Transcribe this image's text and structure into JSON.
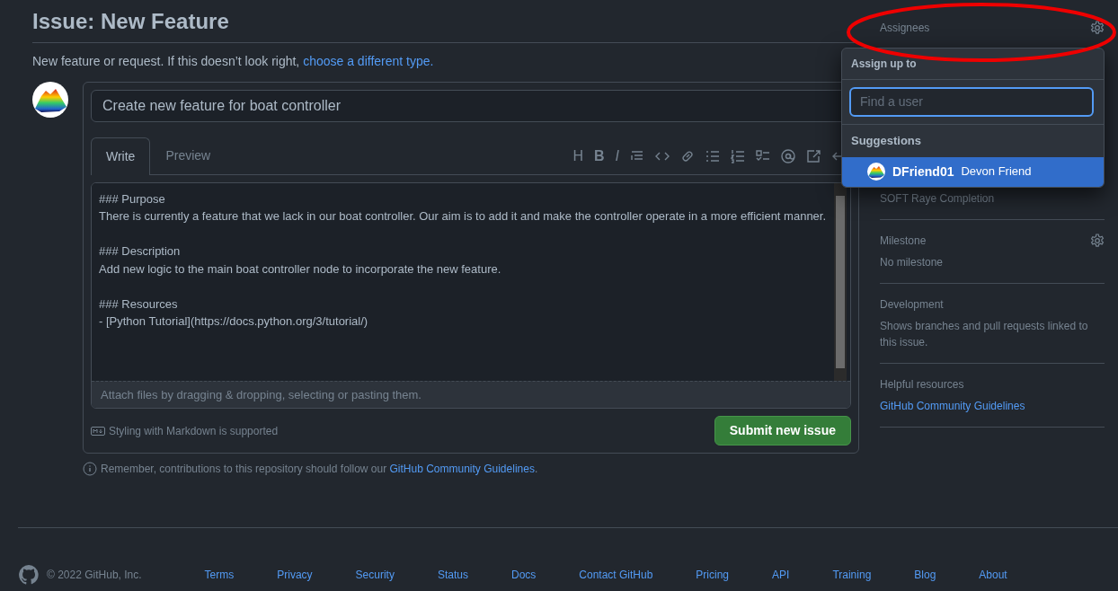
{
  "title": "Issue: New Feature",
  "subtitle": {
    "text": "New feature or request. If this doesn’t look right, ",
    "link": "choose a different type."
  },
  "issue_title": {
    "value": "Create new feature for boat controller"
  },
  "tabs": [
    {
      "label": "Write",
      "selected": true
    },
    {
      "label": "Preview",
      "selected": false
    }
  ],
  "toolbar": [
    "H",
    "B",
    "I"
  ],
  "body": {
    "value": "### Purpose\nThere is currently a feature that we lack in our boat controller. Our aim is to add it and make the controller operate in a more efficient manner.\n\n### Description\nAdd new logic to the main boat controller node to incorporate the new feature.\n\n### Resources\n- [Python Tutorial](https://docs.python.org/3/tutorial/)"
  },
  "attach_hint": "Attach files by dragging & dropping, selecting or pasting them.",
  "markdown_note": "Styling with Markdown is supported",
  "submit_button": "Submit new issue",
  "reminder": {
    "text": "Remember, contributions to this repository should follow our ",
    "link": "GitHub Community Guidelines",
    "end": "."
  },
  "sidebar": {
    "assignees": "Assignees",
    "project_value": "SOFT Raye Completion",
    "sections": [
      {
        "title": "Milestone",
        "gear": true,
        "value": "No milestone",
        "kind": "text"
      },
      {
        "title": "Development",
        "gear": false,
        "value": "Shows branches and pull requests linked to this issue.",
        "kind": "text"
      },
      {
        "title": "Helpful resources",
        "gear": false,
        "value": "GitHub Community Guidelines",
        "kind": "link"
      }
    ]
  },
  "dropdown": {
    "header": "Assign up to",
    "search": {
      "placeholder": "Find a user"
    },
    "suggestions_label": "Suggestions",
    "users": [
      {
        "login": "DFriend01",
        "name": "Devon Friend",
        "selected": true
      }
    ]
  },
  "footer": {
    "copyright": "© 2022 GitHub, Inc.",
    "links": [
      "Terms",
      "Privacy",
      "Security",
      "Status",
      "Docs",
      "Contact GitHub",
      "Pricing",
      "API",
      "Training",
      "Blog",
      "About"
    ]
  }
}
